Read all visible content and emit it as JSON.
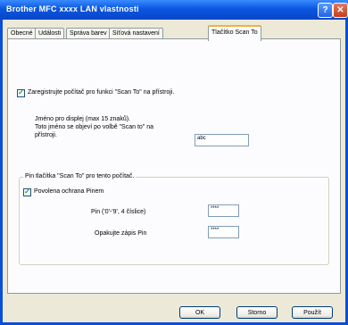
{
  "window": {
    "title": "Brother MFC  xxxx  LAN  vlastnosti",
    "help_label": "?",
    "close_label": "✕"
  },
  "tabs": [
    {
      "label": "Obecné"
    },
    {
      "label": "Události"
    },
    {
      "label": "Správa barev"
    },
    {
      "label": "Síťová nastavení"
    },
    {
      "label": "Tlačítko Scan To"
    }
  ],
  "scanto": {
    "register_checked": true,
    "register_label": "Zaregistrujte počítač pro funkci \"Scan To\" na přístroji.",
    "display_name_label_1": "Jméno pro displej (max 15 znaků).",
    "display_name_label_2": "Toto jméno se objeví po volbě \"Scan to\" na",
    "display_name_label_3": "přístroji.",
    "display_name_value": "abc",
    "pin_group_label": "Pin tlačítka \"Scan To\" pro tento počítač.",
    "pin_protect_checked": true,
    "pin_protect_label": "Povolena ochrana Pinem",
    "pin_label": "Pin ('0'-'9', 4 číslice)",
    "pin_value": "****",
    "pin_confirm_label": "Opakujte zápis Pin",
    "pin_confirm_value": "****"
  },
  "buttons": {
    "ok": "OK",
    "cancel": "Storno",
    "apply": "Použít"
  }
}
